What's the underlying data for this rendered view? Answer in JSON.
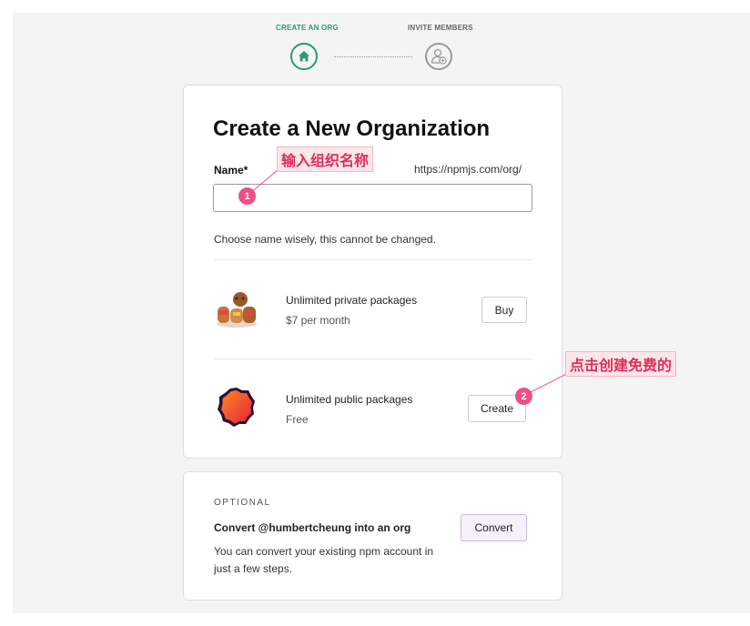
{
  "stepper": {
    "steps": [
      {
        "label": "CREATE AN ORG",
        "icon": "home-icon",
        "state": "active"
      },
      {
        "label": "INVITE MEMBERS",
        "icon": "add-user-icon",
        "state": "inactive"
      }
    ],
    "active_color": "#2a9b6e"
  },
  "form": {
    "title": "Create a New Organization",
    "name_label": "Name*",
    "url_prefix": "https://npmjs.com/org/",
    "name_value": "",
    "hint": "Choose name wisely, this cannot be changed."
  },
  "plans": [
    {
      "title": "Unlimited private packages",
      "subtitle": "$7 per month",
      "button": "Buy",
      "icon": "wombat-group-icon"
    },
    {
      "title": "Unlimited public packages",
      "subtitle": "Free",
      "button": "Create",
      "icon": "npm-badge-icon"
    }
  ],
  "optional": {
    "label": "OPTIONAL",
    "heading": "Convert @humbertcheung into an org",
    "description": "You can convert your existing npm account in just a few steps.",
    "button": "Convert"
  },
  "annotations": [
    {
      "number": "1",
      "text": "输入组织名称"
    },
    {
      "number": "2",
      "text": "点击创建免费的"
    }
  ],
  "colors": {
    "annotation": "#ee4e86",
    "convert_button_bg": "#f7f1fb"
  }
}
